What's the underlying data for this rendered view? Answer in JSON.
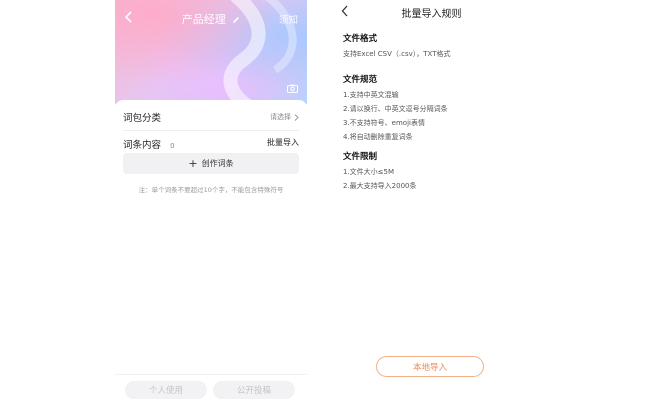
{
  "left_screen": {
    "header": {
      "title": "产品经理",
      "notice_label": "须知"
    },
    "category": {
      "label": "词包分类",
      "choose_label": "请选择"
    },
    "content": {
      "label": "词条内容",
      "count": "0",
      "batch_import_label": "批量导入"
    },
    "create_button_label": "创作词条",
    "hint": "注：单个词条不要超过10个字，不能包含特殊符号",
    "bottom": {
      "personal_use_label": "个人使用",
      "public_submit_label": "公开投稿"
    }
  },
  "right_screen": {
    "title": "批量导入规则",
    "file_format": {
      "heading": "文件格式",
      "lines": [
        "支持Excel CSV（.csv），TXT格式"
      ]
    },
    "file_spec": {
      "heading": "文件规范",
      "lines": [
        "1.支持中英文混输",
        "2.请以换行、中英文逗号分隔词条",
        "3.不支持符号、emoji表情",
        "4.将自动删除重复词条"
      ]
    },
    "file_limit": {
      "heading": "文件限制",
      "lines": [
        "1.文件大小≤5M",
        "2.最大支持导入2000条"
      ]
    },
    "local_import_label": "本地导入"
  },
  "colors": {
    "accent": "#e88a5a",
    "accent_border": "#f2b08a",
    "disabled_text": "#c4c4c4"
  },
  "icons": [
    "back-icon",
    "edit-icon",
    "camera-icon",
    "chevron-right-icon",
    "plus-icon"
  ]
}
